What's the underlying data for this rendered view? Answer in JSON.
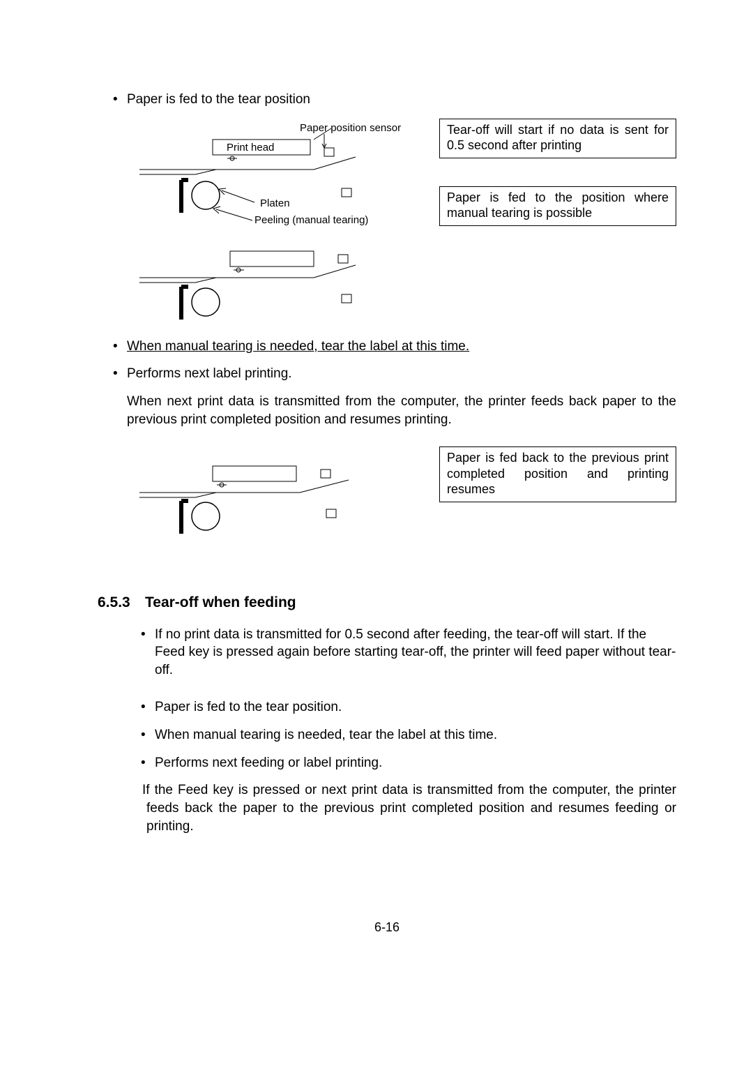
{
  "section1": {
    "bullet1": "Paper is fed to the tear position",
    "fig1": {
      "paperPositionSensor": "Paper position sensor",
      "printHead": "Print head",
      "platen": "Platen",
      "peeling": "Peeling (manual tearing)"
    },
    "box1": "Tear-off will start if no data is sent for 0.5 second after printing",
    "box2": "Paper is fed to the position where manual tearing is possible",
    "bullet2": "When manual tearing is needed, tear the label at this time.",
    "bullet3": "Performs next label printing.",
    "indent1": "When next print data is transmitted from the computer, the printer feeds back paper to the previous print completed position and resumes printing.",
    "box3": "Paper is fed back to the previous print completed position and printing resumes"
  },
  "section2": {
    "number": "6.5.3",
    "title": "Tear-off when feeding",
    "bullet1": "If no print data is transmitted for 0.5 second after feeding, the tear-off will start.    If the Feed key is pressed again before starting tear-off, the printer will feed paper without tear-off.",
    "bullet2": "Paper is fed to the tear position.",
    "bullet3": "When manual tearing is needed, tear the label at this time.",
    "bullet4": "Performs next feeding or label printing.",
    "indent1": "If the Feed key is pressed or next print data is transmitted from the computer, the printer feeds back the paper to the previous print completed position and resumes feeding or printing."
  },
  "page": "6-16"
}
